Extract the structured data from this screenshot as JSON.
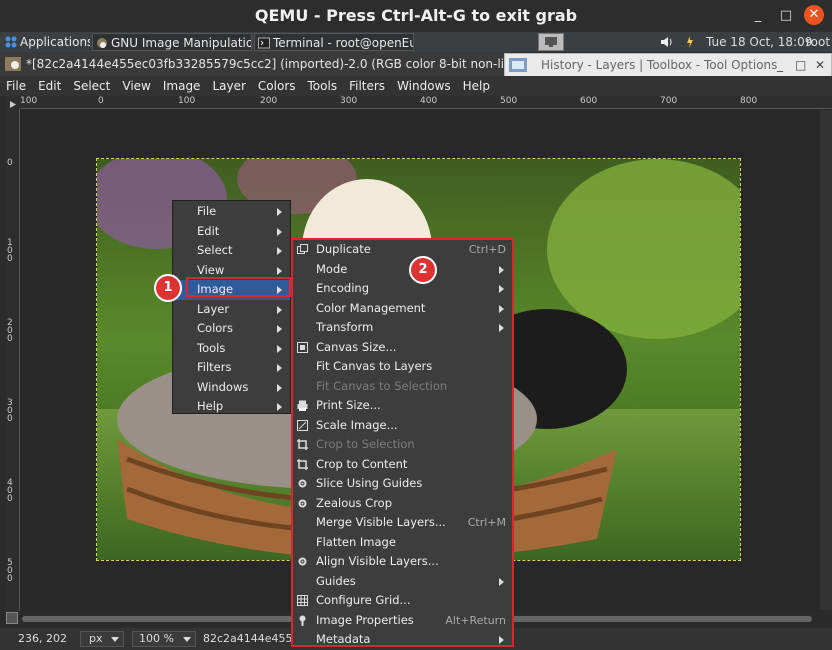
{
  "qemu": {
    "title": "QEMU - Press Ctrl-Alt-G to exit grab",
    "min": "_",
    "max": "□",
    "close": "✕"
  },
  "taskbar": {
    "applications": "Applications",
    "gimp_task": "GNU Image Manipulatio...",
    "terminal_task": "Terminal - root@openEu...",
    "clock": "Tue 18 Oct, 18:09",
    "user": "root"
  },
  "gimp_title": "*[82c2a4144e455ec03fb33285579c5cc2] (imported)-2.0 (RGB color 8-bit non-linear integ",
  "dock_title": "History - Layers | Toolbox - Tool Options",
  "menubar": [
    "File",
    "Edit",
    "Select",
    "View",
    "Image",
    "Layer",
    "Colors",
    "Tools",
    "Filters",
    "Windows",
    "Help"
  ],
  "hruler_ticks": [
    "100",
    "0",
    "100",
    "200",
    "300",
    "400",
    "500",
    "600",
    "700",
    "800"
  ],
  "vruler_ticks": [
    "0",
    "100",
    "200",
    "300",
    "400",
    "500"
  ],
  "context_menu": [
    {
      "label": "File",
      "sub": true
    },
    {
      "label": "Edit",
      "sub": true
    },
    {
      "label": "Select",
      "sub": true
    },
    {
      "label": "View",
      "sub": true
    },
    {
      "label": "Image",
      "sub": true,
      "selected": true
    },
    {
      "label": "Layer",
      "sub": true
    },
    {
      "label": "Colors",
      "sub": true
    },
    {
      "label": "Tools",
      "sub": true
    },
    {
      "label": "Filters",
      "sub": true
    },
    {
      "label": "Windows",
      "sub": true
    },
    {
      "label": "Help",
      "sub": true
    }
  ],
  "image_menu": [
    {
      "label": "Duplicate",
      "acc": "Ctrl+D",
      "icon": "duplicate-icon"
    },
    {
      "label": "Mode",
      "sub": true
    },
    {
      "label": "Encoding",
      "sub": true
    },
    {
      "label": "Color Management",
      "sub": true
    },
    {
      "label": "Transform",
      "sub": true
    },
    {
      "label": "Canvas Size...",
      "icon": "canvas-size-icon"
    },
    {
      "label": "Fit Canvas to Layers"
    },
    {
      "label": "Fit Canvas to Selection",
      "disabled": true
    },
    {
      "label": "Print Size...",
      "icon": "print-icon"
    },
    {
      "label": "Scale Image...",
      "icon": "scale-icon"
    },
    {
      "label": "Crop to Selection",
      "disabled": true,
      "icon": "crop-icon"
    },
    {
      "label": "Crop to Content",
      "icon": "crop-icon"
    },
    {
      "label": "Slice Using Guides",
      "icon": "gear-icon"
    },
    {
      "label": "Zealous Crop",
      "icon": "gear-icon"
    },
    {
      "label": "Merge Visible Layers...",
      "acc": "Ctrl+M"
    },
    {
      "label": "Flatten Image"
    },
    {
      "label": "Align Visible Layers...",
      "icon": "gear-icon"
    },
    {
      "label": "Guides",
      "sub": true
    },
    {
      "label": "Configure Grid...",
      "icon": "grid-icon"
    },
    {
      "label": "Image Properties",
      "acc": "Alt+Return",
      "icon": "info-icon"
    },
    {
      "label": "Metadata",
      "sub": true
    }
  ],
  "badges": {
    "one": "1",
    "two": "2"
  },
  "status": {
    "coords": "236, 202",
    "unit": "px",
    "zoom": "100 %",
    "file": "82c2a4144e455"
  },
  "colors": {
    "highlight": "#2e5b9a",
    "annotation": "#d9272d"
  }
}
